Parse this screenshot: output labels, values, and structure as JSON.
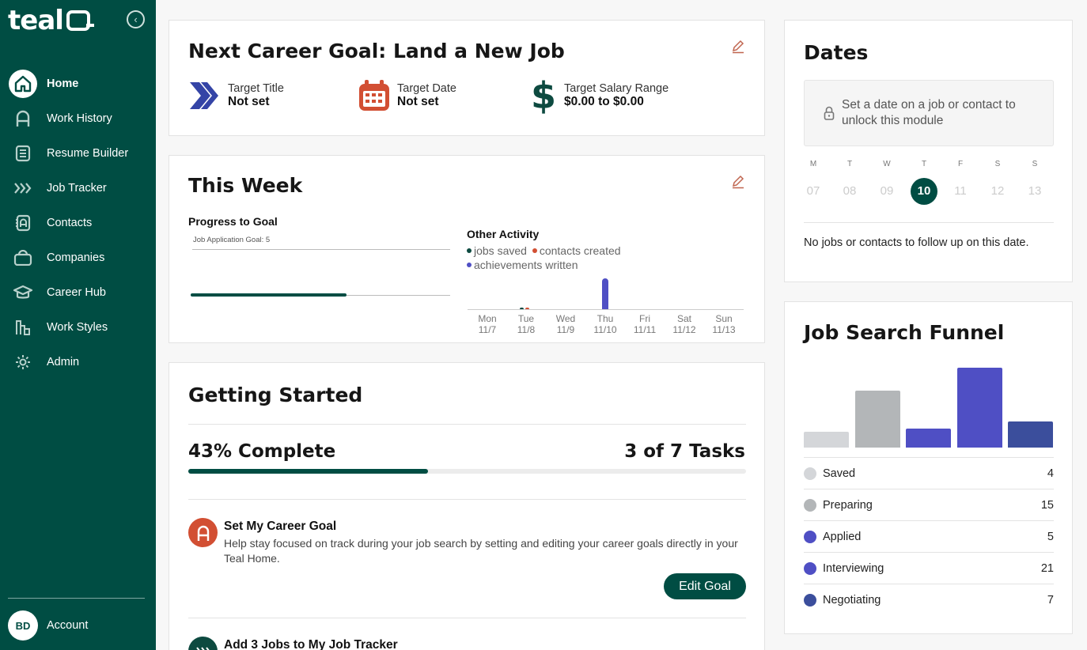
{
  "sidebar": {
    "logo": "teal",
    "items": [
      {
        "label": "Home",
        "icon": "home-icon",
        "active": true
      },
      {
        "label": "Work History",
        "icon": "person-icon"
      },
      {
        "label": "Resume Builder",
        "icon": "document-icon"
      },
      {
        "label": "Job Tracker",
        "icon": "chevrons-icon"
      },
      {
        "label": "Contacts",
        "icon": "contacts-icon"
      },
      {
        "label": "Companies",
        "icon": "briefcase-icon"
      },
      {
        "label": "Career Hub",
        "icon": "graduation-cap-icon"
      },
      {
        "label": "Work Styles",
        "icon": "bar-chart-icon"
      },
      {
        "label": "Admin",
        "icon": "gear-icon"
      }
    ],
    "account": {
      "initials": "BD",
      "label": "Account"
    }
  },
  "goal": {
    "title": "Next Career Goal: Land a New Job",
    "target_title_label": "Target Title",
    "target_title_value": "Not set",
    "target_date_label": "Target Date",
    "target_date_value": "Not set",
    "salary_label": "Target Salary Range",
    "salary_value": "$0.00 to $0.00"
  },
  "week": {
    "title": "This Week",
    "progress_title": "Progress to Goal",
    "goal_caption": "Job Application Goal: 5",
    "progress_fraction": 0.6,
    "other_title": "Other Activity",
    "legend": [
      "jobs saved",
      "contacts created",
      "achievements written"
    ],
    "days": [
      {
        "d": "Mon",
        "date": "11/7"
      },
      {
        "d": "Tue",
        "date": "11/8"
      },
      {
        "d": "Wed",
        "date": "11/9"
      },
      {
        "d": "Thu",
        "date": "11/10"
      },
      {
        "d": "Fri",
        "date": "11/11"
      },
      {
        "d": "Sat",
        "date": "11/12"
      },
      {
        "d": "Sun",
        "date": "11/13"
      }
    ]
  },
  "getting_started": {
    "title": "Getting Started",
    "percent_text": "43% Complete",
    "tasks_text": "3 of 7 Tasks",
    "progress_fraction": 0.43,
    "task1_title": "Set My Career Goal",
    "task1_desc": "Help stay focused on track during your job search by setting and editing your career goals directly in your Teal Home.",
    "task1_button": "Edit Goal",
    "task2_title": "Add 3 Jobs to My Job Tracker"
  },
  "dates": {
    "title": "Dates",
    "locked_text": "Set a date on a job or contact to unlock this module",
    "weekdays": [
      "M",
      "T",
      "W",
      "T",
      "F",
      "S",
      "S"
    ],
    "numbers": [
      "07",
      "08",
      "09",
      "10",
      "11",
      "12",
      "13"
    ],
    "today_index": 3,
    "message": "No jobs or contacts to follow up on this date."
  },
  "funnel": {
    "title": "Job Search Funnel",
    "stages": [
      {
        "name": "Saved",
        "value": "4",
        "color": "#d4d6d9"
      },
      {
        "name": "Preparing",
        "value": "15",
        "color": "#b3b6b8"
      },
      {
        "name": "Applied",
        "value": "5",
        "color": "#4f4fc4"
      },
      {
        "name": "Interviewing",
        "value": "21",
        "color": "#4f4fc4"
      },
      {
        "name": "Negotiating",
        "value": "7",
        "color": "#3b4e9c"
      }
    ]
  }
}
